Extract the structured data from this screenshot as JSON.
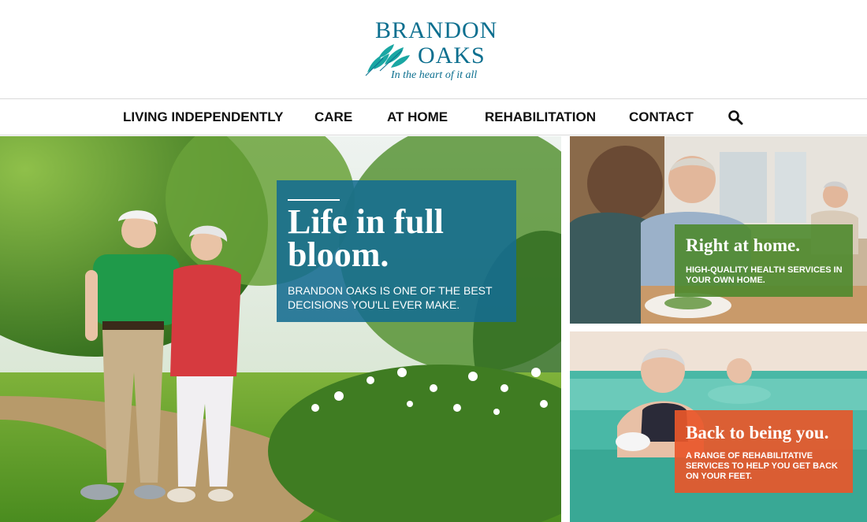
{
  "brand": {
    "name_line1": "BRANDON",
    "name_line2": "OAKS",
    "tagline": "In the heart of it all",
    "color": "#0c6f8f"
  },
  "nav": {
    "items": [
      {
        "label": "LIVING INDEPENDENTLY"
      },
      {
        "label": "CARE"
      },
      {
        "label": "AT HOME"
      },
      {
        "label": "REHABILITATION"
      },
      {
        "label": "CONTACT"
      }
    ],
    "search_icon": "search-icon"
  },
  "hero": {
    "title": "Life in full bloom.",
    "subtitle": "BRANDON OAKS IS ONE OF THE BEST DECISIONS YOU'LL EVER MAKE.",
    "box_color": "#146c91"
  },
  "panels": [
    {
      "title": "Right at home.",
      "subtitle": "HIGH-QUALITY HEALTH SERVICES IN YOUR OWN HOME.",
      "box_color": "#4e8a2e"
    },
    {
      "title": "Back to being you.",
      "subtitle": "A RANGE OF REHABILITATIVE SERVICES TO HELP YOU GET BACK ON YOUR FEET.",
      "box_color": "#e8572a"
    }
  ]
}
